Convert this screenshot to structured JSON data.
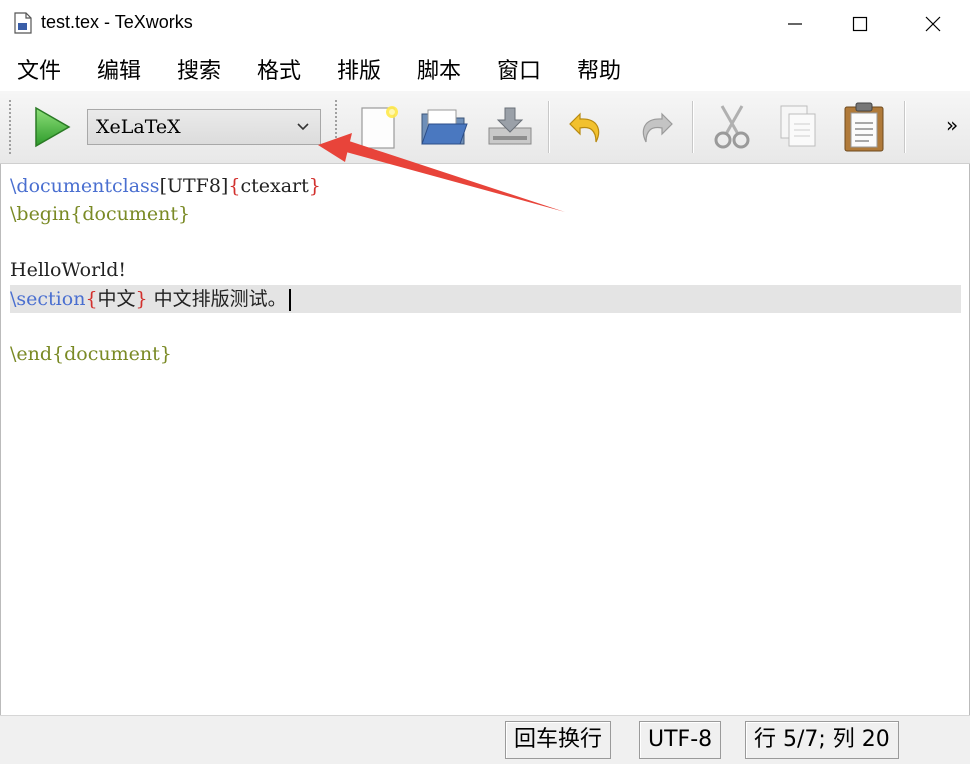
{
  "window": {
    "title": "test.tex - TeXworks",
    "controls": {
      "minimize": "—",
      "maximize": "☐",
      "close": "✕"
    }
  },
  "menu": [
    "文件",
    "编辑",
    "搜索",
    "格式",
    "排版",
    "脚本",
    "窗口",
    "帮助"
  ],
  "toolbar": {
    "typeset_icon": "play-icon",
    "engine": "XeLaTeX",
    "buttons": [
      "new-document-icon",
      "open-folder-icon",
      "save-icon",
      "undo-icon",
      "redo-icon",
      "cut-icon",
      "copy-icon",
      "paste-icon"
    ],
    "overflow_label": "»"
  },
  "editor": {
    "lines": [
      {
        "cmd": "\\documentclass",
        "opt": "[UTF8]",
        "b1": "{",
        "arg": "ctexart",
        "b2": "}",
        "rest": ""
      },
      {
        "cmd": "\\begin",
        "env": "{document}"
      },
      {
        "text": ""
      },
      {
        "text": "HelloWorld!"
      },
      {
        "cmd": "\\section",
        "b1": "{",
        "arg": "中文",
        "b2": "}",
        "rest": " 中文排版测试。"
      },
      {
        "text": ""
      },
      {
        "cmd": "\\end",
        "env": "{document}"
      }
    ],
    "current_line": 5
  },
  "status": {
    "line_ending": "回车换行",
    "encoding": "UTF-8",
    "position": "行 5/7;  列 20"
  },
  "colors": {
    "command": "#4a6fd0",
    "bracket": "#d2302d",
    "environment": "#7a8a25",
    "annotation_arrow": "#e8443a"
  }
}
